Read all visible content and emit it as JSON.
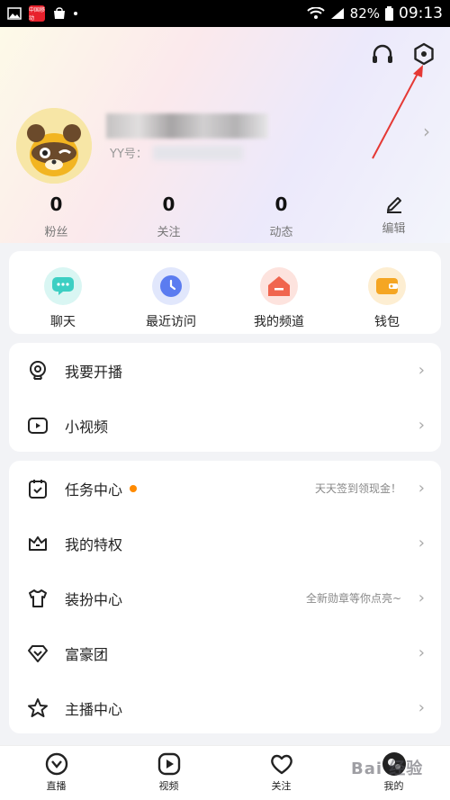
{
  "status_bar": {
    "battery": "82%",
    "time": "09:13",
    "app_badge": "中国移动"
  },
  "profile": {
    "yy_label": "YY号："
  },
  "stats": [
    {
      "value": "0",
      "label": "粉丝"
    },
    {
      "value": "0",
      "label": "关注"
    },
    {
      "value": "0",
      "label": "动态"
    },
    {
      "label": "编辑"
    }
  ],
  "quick_actions": [
    {
      "label": "聊天",
      "icon": "chat-icon",
      "color": "#3ccfc3"
    },
    {
      "label": "最近访问",
      "icon": "clock-icon",
      "color": "#5b7cf0"
    },
    {
      "label": "我的频道",
      "icon": "home-icon",
      "color": "#f0654e"
    },
    {
      "label": "钱包",
      "icon": "wallet-icon",
      "color": "#f5a623"
    }
  ],
  "group1": [
    {
      "label": "我要开播",
      "icon": "broadcast-icon"
    },
    {
      "label": "小视频",
      "icon": "video-icon"
    }
  ],
  "group2": [
    {
      "label": "任务中心",
      "icon": "calendar-check-icon",
      "hint": "天天签到领现金！",
      "badge": true
    },
    {
      "label": "我的特权",
      "icon": "crown-icon",
      "hint": ""
    },
    {
      "label": "装扮中心",
      "icon": "shirt-icon",
      "hint": "全新勋章等你点亮~"
    },
    {
      "label": "富豪团",
      "icon": "diamond-icon",
      "hint": ""
    },
    {
      "label": "主播中心",
      "icon": "star-icon",
      "hint": ""
    }
  ],
  "tabs": [
    {
      "label": "直播",
      "icon": "live-icon"
    },
    {
      "label": "视频",
      "icon": "play-icon"
    },
    {
      "label": "关注",
      "icon": "heart-icon"
    },
    {
      "label": "我的",
      "icon": "avatar-icon"
    }
  ],
  "watermark": "Bai 经验",
  "colors": {
    "accent_badge": "#ff8a00",
    "annotation_arrow": "#e53935"
  }
}
